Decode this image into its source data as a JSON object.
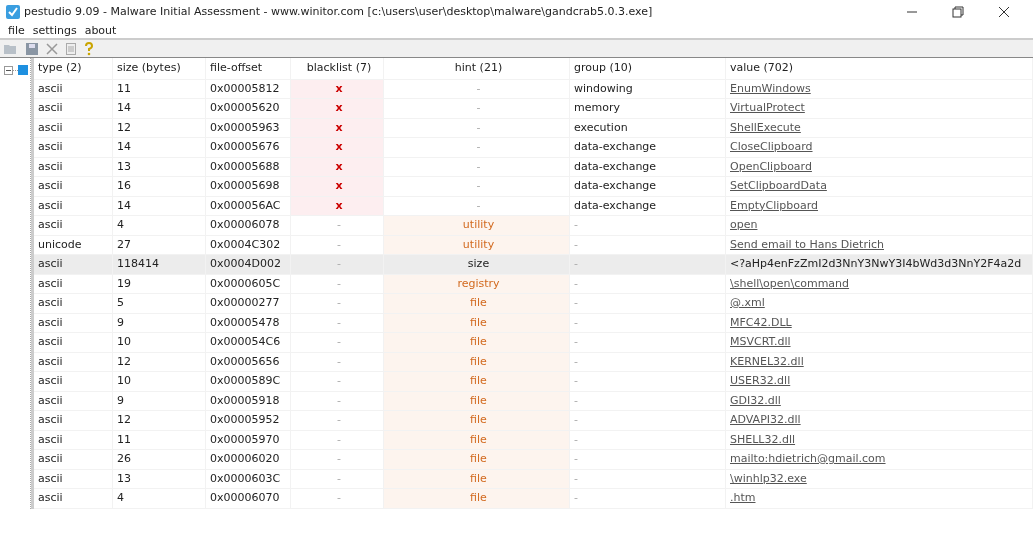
{
  "window": {
    "title": "pestudio 9.09 - Malware Initial Assessment - www.winitor.com [c:\\users\\user\\desktop\\malware\\gandcrab5.0.3.exe]"
  },
  "menu": [
    "file",
    "settings",
    "about"
  ],
  "table": {
    "columns": [
      "type (2)",
      "size (bytes)",
      "file-offset",
      "blacklist (7)",
      "hint (21)",
      "group (10)",
      "value (702)"
    ],
    "rows": [
      {
        "type": "ascii",
        "size": "11",
        "offset": "0x00005812",
        "blacklist": "x",
        "blacklisted": true,
        "hint": "-",
        "hint_flagged": false,
        "group": "windowing",
        "value": "EnumWindows",
        "selected": false
      },
      {
        "type": "ascii",
        "size": "14",
        "offset": "0x00005620",
        "blacklist": "x",
        "blacklisted": true,
        "hint": "-",
        "hint_flagged": false,
        "group": "memory",
        "value": "VirtualProtect",
        "selected": false
      },
      {
        "type": "ascii",
        "size": "12",
        "offset": "0x00005963",
        "blacklist": "x",
        "blacklisted": true,
        "hint": "-",
        "hint_flagged": false,
        "group": "execution",
        "value": "ShellExecute",
        "selected": false
      },
      {
        "type": "ascii",
        "size": "14",
        "offset": "0x00005676",
        "blacklist": "x",
        "blacklisted": true,
        "hint": "-",
        "hint_flagged": false,
        "group": "data-exchange",
        "value": "CloseClipboard",
        "selected": false
      },
      {
        "type": "ascii",
        "size": "13",
        "offset": "0x00005688",
        "blacklist": "x",
        "blacklisted": true,
        "hint": "-",
        "hint_flagged": false,
        "group": "data-exchange",
        "value": "OpenClipboard",
        "selected": false
      },
      {
        "type": "ascii",
        "size": "16",
        "offset": "0x00005698",
        "blacklist": "x",
        "blacklisted": true,
        "hint": "-",
        "hint_flagged": false,
        "group": "data-exchange",
        "value": "SetClipboardData",
        "selected": false
      },
      {
        "type": "ascii",
        "size": "14",
        "offset": "0x000056AC",
        "blacklist": "x",
        "blacklisted": true,
        "hint": "-",
        "hint_flagged": false,
        "group": "data-exchange",
        "value": "EmptyClipboard",
        "selected": false
      },
      {
        "type": "ascii",
        "size": "4",
        "offset": "0x00006078",
        "blacklist": "-",
        "blacklisted": false,
        "hint": "utility",
        "hint_flagged": true,
        "group": "-",
        "value": "open",
        "selected": false
      },
      {
        "type": "unicode",
        "size": "27",
        "offset": "0x0004C302",
        "blacklist": "-",
        "blacklisted": false,
        "hint": "utility",
        "hint_flagged": true,
        "group": "-",
        "value": "Send email to Hans Dietrich",
        "selected": false
      },
      {
        "type": "ascii",
        "size": "118414",
        "offset": "0x0004D002",
        "blacklist": "-",
        "blacklisted": false,
        "hint": "size",
        "hint_flagged": true,
        "group": "-",
        "value": "<?aHp4enFzZmI2d3NnY3NwY3I4bWd3d3NnY2F4a2d",
        "selected": true
      },
      {
        "type": "ascii",
        "size": "19",
        "offset": "0x0000605C",
        "blacklist": "-",
        "blacklisted": false,
        "hint": "registry",
        "hint_flagged": true,
        "group": "-",
        "value": "\\shell\\open\\command",
        "selected": false
      },
      {
        "type": "ascii",
        "size": "5",
        "offset": "0x00000277",
        "blacklist": "-",
        "blacklisted": false,
        "hint": "file",
        "hint_flagged": true,
        "group": "-",
        "value": "@.xml",
        "selected": false
      },
      {
        "type": "ascii",
        "size": "9",
        "offset": "0x00005478",
        "blacklist": "-",
        "blacklisted": false,
        "hint": "file",
        "hint_flagged": true,
        "group": "-",
        "value": "MFC42.DLL",
        "selected": false
      },
      {
        "type": "ascii",
        "size": "10",
        "offset": "0x000054C6",
        "blacklist": "-",
        "blacklisted": false,
        "hint": "file",
        "hint_flagged": true,
        "group": "-",
        "value": "MSVCRT.dll",
        "selected": false
      },
      {
        "type": "ascii",
        "size": "12",
        "offset": "0x00005656",
        "blacklist": "-",
        "blacklisted": false,
        "hint": "file",
        "hint_flagged": true,
        "group": "-",
        "value": "KERNEL32.dll",
        "selected": false
      },
      {
        "type": "ascii",
        "size": "10",
        "offset": "0x0000589C",
        "blacklist": "-",
        "blacklisted": false,
        "hint": "file",
        "hint_flagged": true,
        "group": "-",
        "value": "USER32.dll",
        "selected": false
      },
      {
        "type": "ascii",
        "size": "9",
        "offset": "0x00005918",
        "blacklist": "-",
        "blacklisted": false,
        "hint": "file",
        "hint_flagged": true,
        "group": "-",
        "value": "GDI32.dll",
        "selected": false
      },
      {
        "type": "ascii",
        "size": "12",
        "offset": "0x00005952",
        "blacklist": "-",
        "blacklisted": false,
        "hint": "file",
        "hint_flagged": true,
        "group": "-",
        "value": "ADVAPI32.dll",
        "selected": false
      },
      {
        "type": "ascii",
        "size": "11",
        "offset": "0x00005970",
        "blacklist": "-",
        "blacklisted": false,
        "hint": "file",
        "hint_flagged": true,
        "group": "-",
        "value": "SHELL32.dll",
        "selected": false
      },
      {
        "type": "ascii",
        "size": "26",
        "offset": "0x00006020",
        "blacklist": "-",
        "blacklisted": false,
        "hint": "file",
        "hint_flagged": true,
        "group": "-",
        "value": "mailto:hdietrich@gmail.com",
        "selected": false
      },
      {
        "type": "ascii",
        "size": "13",
        "offset": "0x0000603C",
        "blacklist": "-",
        "blacklisted": false,
        "hint": "file",
        "hint_flagged": true,
        "group": "-",
        "value": "\\winhlp32.exe",
        "selected": false
      },
      {
        "type": "ascii",
        "size": "4",
        "offset": "0x00006070",
        "blacklist": "-",
        "blacklisted": false,
        "hint": "file",
        "hint_flagged": true,
        "group": "-",
        "value": ".htm",
        "selected": false
      }
    ]
  }
}
